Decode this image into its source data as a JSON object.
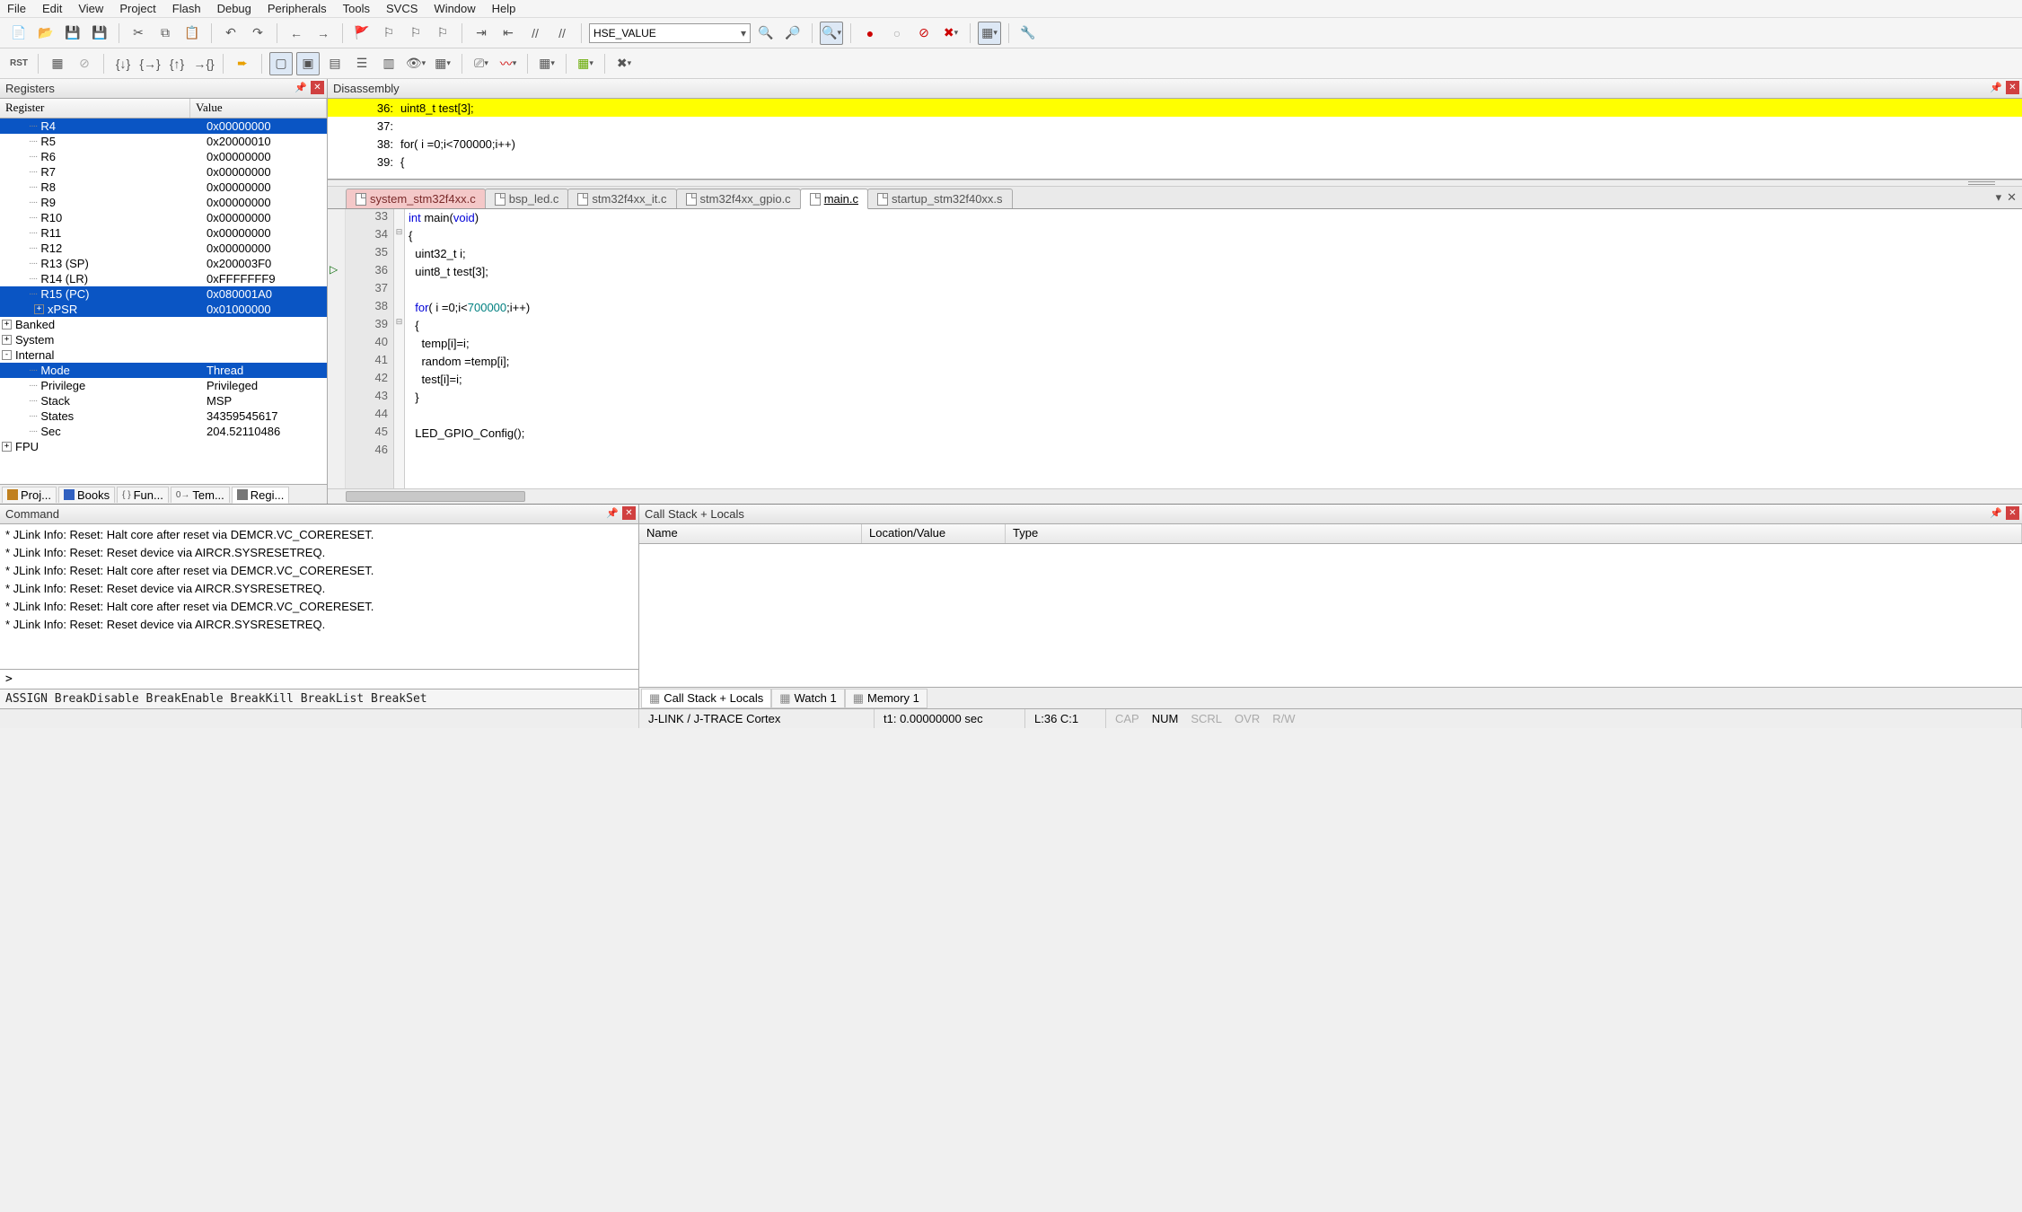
{
  "menu": [
    "File",
    "Edit",
    "View",
    "Project",
    "Flash",
    "Debug",
    "Peripherals",
    "Tools",
    "SVCS",
    "Window",
    "Help"
  ],
  "combo": "HSE_VALUE",
  "panels": {
    "registers": "Registers",
    "disassembly": "Disassembly",
    "command": "Command",
    "callstack": "Call Stack + Locals"
  },
  "regcols": {
    "c1": "Register",
    "c2": "Value"
  },
  "registers": [
    {
      "n": "R4",
      "v": "0x00000000",
      "sel": true,
      "ind": 2
    },
    {
      "n": "R5",
      "v": "0x20000010",
      "ind": 2
    },
    {
      "n": "R6",
      "v": "0x00000000",
      "ind": 2
    },
    {
      "n": "R7",
      "v": "0x00000000",
      "ind": 2
    },
    {
      "n": "R8",
      "v": "0x00000000",
      "ind": 2
    },
    {
      "n": "R9",
      "v": "0x00000000",
      "ind": 2
    },
    {
      "n": "R10",
      "v": "0x00000000",
      "ind": 2
    },
    {
      "n": "R11",
      "v": "0x00000000",
      "ind": 2
    },
    {
      "n": "R12",
      "v": "0x00000000",
      "ind": 2
    },
    {
      "n": "R13 (SP)",
      "v": "0x200003F0",
      "ind": 2
    },
    {
      "n": "R14 (LR)",
      "v": "0xFFFFFFF9",
      "ind": 2
    },
    {
      "n": "R15 (PC)",
      "v": "0x080001A0",
      "sel": true,
      "ind": 2
    },
    {
      "n": "xPSR",
      "v": "0x01000000",
      "sel": true,
      "ind": 2,
      "box": "+"
    },
    {
      "n": "Banked",
      "v": "",
      "ind": 1,
      "box": "+"
    },
    {
      "n": "System",
      "v": "",
      "ind": 1,
      "box": "+"
    },
    {
      "n": "Internal",
      "v": "",
      "ind": 1,
      "box": "-"
    },
    {
      "n": "Mode",
      "v": "Thread",
      "sel": true,
      "ind": 2
    },
    {
      "n": "Privilege",
      "v": "Privileged",
      "ind": 2
    },
    {
      "n": "Stack",
      "v": "MSP",
      "ind": 2
    },
    {
      "n": "States",
      "v": "34359545617",
      "ind": 2
    },
    {
      "n": "Sec",
      "v": "204.52110486",
      "ind": 2
    },
    {
      "n": "FPU",
      "v": "",
      "ind": 1,
      "box": "+"
    }
  ],
  "sidetabs": [
    {
      "l": "Proj...",
      "ico": "#c08020"
    },
    {
      "l": "Books",
      "ico": "#3060c0"
    },
    {
      "l": "Fun...",
      "ico": "#555",
      "pre": "{ }"
    },
    {
      "l": "Tem...",
      "ico": "#555",
      "pre": "0→"
    },
    {
      "l": "Regi...",
      "ico": "#777",
      "active": true
    }
  ],
  "disasm": [
    {
      "ln": "36:",
      "c": "        uint8_t test[3];",
      "hl": true
    },
    {
      "ln": "37:",
      "c": ""
    },
    {
      "ln": "38:",
      "c": "        for( i =0;i<700000;i++)"
    },
    {
      "ln": "39:",
      "c": "        {"
    }
  ],
  "tabs": [
    {
      "l": "system_stm32f4xx.c",
      "cls": "pink"
    },
    {
      "l": "bsp_led.c",
      "cls": "inactive"
    },
    {
      "l": "stm32f4xx_it.c",
      "cls": "inactive"
    },
    {
      "l": "stm32f4xx_gpio.c",
      "cls": "inactive"
    },
    {
      "l": "main.c",
      "cls": "active",
      "u": true
    },
    {
      "l": "startup_stm32f40xx.s",
      "cls": "inactive"
    }
  ],
  "code": [
    {
      "n": 33,
      "h": "<span class='kw'>int</span> main(<span class='kw'>void</span>)"
    },
    {
      "n": 34,
      "h": "{"
    },
    {
      "n": 35,
      "h": "  uint32_t i;"
    },
    {
      "n": 36,
      "h": "  uint8_t test[3];",
      "arrow": true
    },
    {
      "n": 37,
      "h": ""
    },
    {
      "n": 38,
      "h": "  <span class='kw'>for</span>( i =0;i&lt;<span class='num'>700000</span>;i++)"
    },
    {
      "n": 39,
      "h": "  {"
    },
    {
      "n": 40,
      "h": "    temp[i]=i;"
    },
    {
      "n": 41,
      "h": "    random =temp[i];"
    },
    {
      "n": 42,
      "h": "    test[i]=i;"
    },
    {
      "n": 43,
      "h": "  }"
    },
    {
      "n": 44,
      "h": ""
    },
    {
      "n": 45,
      "h": "  LED_GPIO_Config();"
    },
    {
      "n": 46,
      "h": ""
    }
  ],
  "cmd": [
    "* JLink Info: Reset: Halt core after reset via DEMCR.VC_CORERESET.",
    "* JLink Info: Reset: Reset device via AIRCR.SYSRESETREQ.",
    "* JLink Info: Reset: Halt core after reset via DEMCR.VC_CORERESET.",
    "* JLink Info: Reset: Reset device via AIRCR.SYSRESETREQ.",
    "* JLink Info: Reset: Halt core after reset via DEMCR.VC_CORERESET.",
    "* JLink Info: Reset: Reset device via AIRCR.SYSRESETREQ."
  ],
  "cmdprompt": ">",
  "cmdbuttons": "ASSIGN BreakDisable BreakEnable BreakKill BreakList BreakSet",
  "callcols": {
    "name": "Name",
    "loc": "Location/Value",
    "type": "Type"
  },
  "calltabs": [
    {
      "l": "Call Stack + Locals",
      "active": true
    },
    {
      "l": "Watch 1"
    },
    {
      "l": "Memory 1"
    }
  ],
  "status": {
    "dev": "J-LINK / J-TRACE Cortex",
    "t1": "t1: 0.00000000 sec",
    "pos": "L:36 C:1",
    "caps": [
      "CAP",
      "NUM",
      "SCRL",
      "OVR",
      "R/W"
    ]
  }
}
